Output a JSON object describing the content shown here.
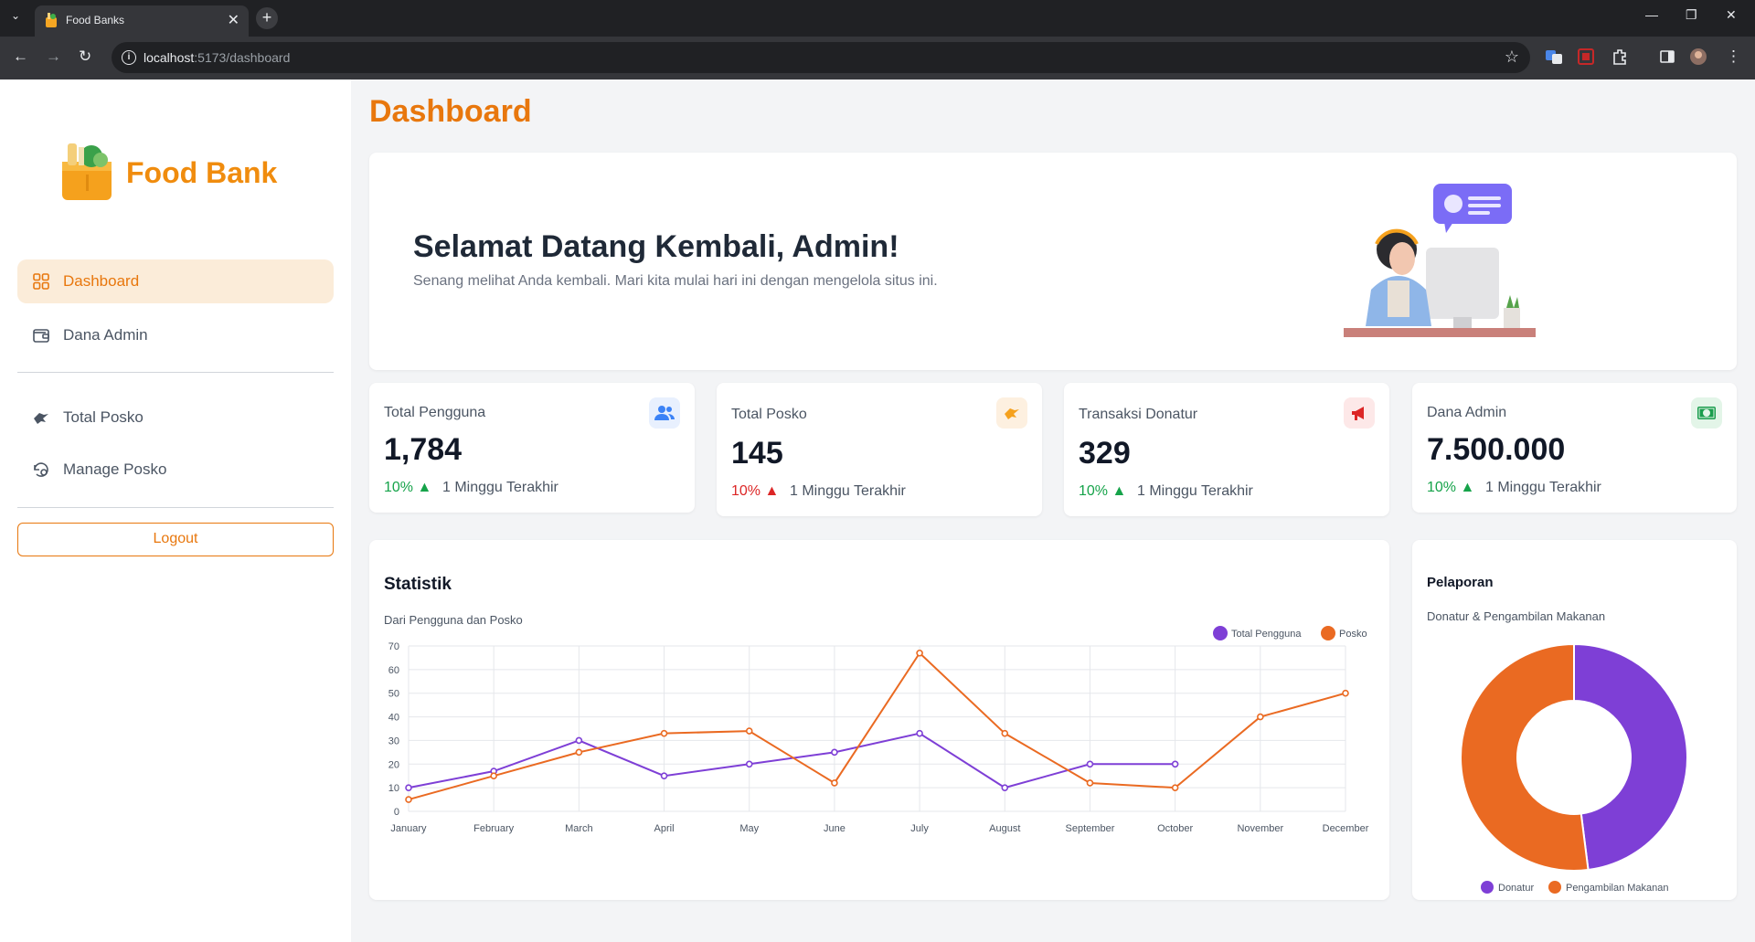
{
  "browser": {
    "tab_title": "Food Banks",
    "url_host": "localhost",
    "url_path": ":5173/dashboard"
  },
  "sidebar": {
    "logo_text": "Food Bank",
    "items": [
      {
        "label": "Dashboard",
        "icon": "grid-icon",
        "active": true
      },
      {
        "label": "Dana Admin",
        "icon": "wallet-icon",
        "active": false
      },
      {
        "label": "Total Posko",
        "icon": "hand-heart-icon",
        "active": false
      },
      {
        "label": "Manage Posko",
        "icon": "settings-history-icon",
        "active": false
      }
    ],
    "logout_label": "Logout"
  },
  "page": {
    "title": "Dashboard"
  },
  "welcome": {
    "heading": "Selamat Datang Kembali, Admin!",
    "subtitle": "Senang melihat Anda kembali. Mari kita mulai hari ini dengan mengelola situs ini."
  },
  "stats": [
    {
      "label": "Total Pengguna",
      "value": "1,784",
      "delta": "10%",
      "trend": "up",
      "delta_color": "#16a34a",
      "period": "1 Minggu Terakhir",
      "icon": "users-icon",
      "icon_color": "#3b82f6",
      "icon_bg": "#e8f0fe"
    },
    {
      "label": "Total Posko",
      "value": "145",
      "delta": "10%",
      "trend": "up",
      "delta_color": "#dc2626",
      "period": "1 Minggu Terakhir",
      "icon": "hand-heart-icon",
      "icon_color": "#f59e0b",
      "icon_bg": "#fdf0e0"
    },
    {
      "label": "Transaksi Donatur",
      "value": "329",
      "delta": "10%",
      "trend": "up",
      "delta_color": "#16a34a",
      "period": "1 Minggu Terakhir",
      "icon": "megaphone-icon",
      "icon_color": "#dc2626",
      "icon_bg": "#fde8e8"
    },
    {
      "label": "Dana Admin",
      "value": "7.500.000",
      "delta": "10%",
      "trend": "up",
      "delta_color": "#16a34a",
      "period": "1 Minggu Terakhir",
      "icon": "money-icon",
      "icon_color": "#16a34a",
      "icon_bg": "#e3f5e8"
    }
  ],
  "statistik": {
    "title": "Statistik",
    "subtitle": "Dari Pengguna dan Posko"
  },
  "pelaporan": {
    "title": "Pelaporan",
    "subtitle": "Donatur & Pengambilan Makanan"
  },
  "chart_data": [
    {
      "type": "line",
      "categories": [
        "January",
        "February",
        "March",
        "April",
        "May",
        "June",
        "July",
        "August",
        "September",
        "October",
        "November",
        "December"
      ],
      "series": [
        {
          "name": "Total Pengguna",
          "color": "#7e3fd6",
          "values": [
            10,
            17,
            30,
            15,
            20,
            25,
            33,
            10,
            20,
            20,
            null,
            null
          ]
        },
        {
          "name": "Posko",
          "color": "#ea6a22",
          "values": [
            5,
            15,
            25,
            33,
            34,
            12,
            67,
            33,
            12,
            10,
            40,
            50
          ]
        }
      ],
      "ylim": [
        0,
        70
      ],
      "yticks": [
        0,
        10,
        20,
        30,
        40,
        50,
        60,
        70
      ],
      "grid": true,
      "legend": "top-right"
    },
    {
      "type": "pie",
      "donut": true,
      "labels": [
        "Donatur",
        "Pengambilan Makanan"
      ],
      "values": [
        48,
        52
      ],
      "colors": [
        "#7e3fd6",
        "#ea6a22"
      ],
      "legend": "bottom"
    }
  ]
}
